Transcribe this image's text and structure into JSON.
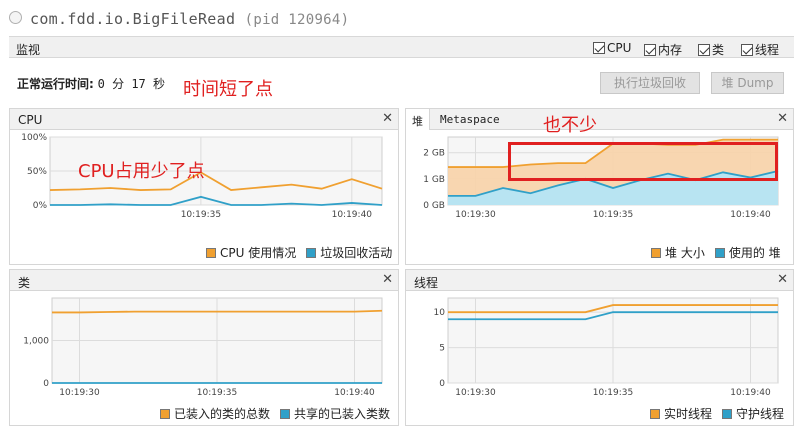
{
  "window": {
    "title": "com.fdd.io.BigFileRead",
    "pid": "(pid 120964)"
  },
  "monitor": {
    "label": "监视",
    "checkboxes": [
      {
        "label": "CPU",
        "checked": true
      },
      {
        "label": "内存",
        "checked": true
      },
      {
        "label": "类",
        "checked": true
      },
      {
        "label": "线程",
        "checked": true
      }
    ]
  },
  "uptime": {
    "label": "正常运行时间:",
    "value": "0 分 17 秒"
  },
  "buttons": {
    "gc": "执行垃圾回收",
    "dump": "堆 Dump"
  },
  "annotations": {
    "time": "时间短了点",
    "cpu": "CPU占用少了点",
    "heap": "也不少"
  },
  "colors": {
    "orange": "#f0a030",
    "orange_fill": "#f8d3a8",
    "blue": "#30a0c8",
    "blue_fill": "#b8e4f2",
    "annotation": "#e02020"
  },
  "panels": {
    "cpu": {
      "title": "CPU",
      "legend": [
        "CPU 使用情况",
        "垃圾回收活动"
      ]
    },
    "heap": {
      "tabs": [
        "堆",
        "Metaspace"
      ],
      "legend": [
        "堆 大小",
        "使用的 堆"
      ]
    },
    "classes": {
      "title": "类",
      "legend": [
        "已装入的类的总数",
        "共享的已装入类数"
      ]
    },
    "threads": {
      "title": "线程",
      "legend": [
        "实时线程",
        "守护线程"
      ]
    }
  },
  "chart_data": [
    {
      "type": "line",
      "panel": "cpu",
      "x": [
        "10:19:30",
        "10:19:31",
        "10:19:32",
        "10:19:33",
        "10:19:34",
        "10:19:35",
        "10:19:36",
        "10:19:37",
        "10:19:38",
        "10:19:39",
        "10:19:40",
        "10:19:41"
      ],
      "xticks": [
        "10:19:35",
        "10:19:40"
      ],
      "yticks": [
        "0%",
        "50%",
        "100%"
      ],
      "ylim": [
        0,
        100
      ],
      "series": [
        {
          "name": "CPU 使用情况",
          "values": [
            22,
            23,
            25,
            22,
            23,
            48,
            22,
            26,
            30,
            24,
            38,
            24
          ]
        },
        {
          "name": "垃圾回收活动",
          "values": [
            0,
            0,
            1,
            0,
            0,
            12,
            0,
            0,
            2,
            0,
            3,
            0
          ]
        }
      ]
    },
    {
      "type": "area",
      "panel": "heap",
      "x": [
        "10:19:29",
        "10:19:30",
        "10:19:31",
        "10:19:32",
        "10:19:33",
        "10:19:34",
        "10:19:35",
        "10:19:36",
        "10:19:37",
        "10:19:38",
        "10:19:39",
        "10:19:40",
        "10:19:41"
      ],
      "xticks": [
        "10:19:30",
        "10:19:35",
        "10:19:40"
      ],
      "yticks": [
        "0 GB",
        "1 GB",
        "2 GB"
      ],
      "ylim": [
        0,
        2.6
      ],
      "series": [
        {
          "name": "堆 大小",
          "values": [
            1.45,
            1.45,
            1.45,
            1.55,
            1.6,
            1.6,
            2.35,
            2.35,
            2.3,
            2.3,
            2.5,
            2.5,
            2.5
          ]
        },
        {
          "name": "使用的 堆",
          "values": [
            0.35,
            0.35,
            0.65,
            0.45,
            0.75,
            1.0,
            0.65,
            0.95,
            1.2,
            0.95,
            1.25,
            1.05,
            1.3
          ]
        }
      ]
    },
    {
      "type": "line",
      "panel": "classes",
      "x": [
        "10:19:29",
        "10:19:30",
        "10:19:31",
        "10:19:32",
        "10:19:33",
        "10:19:34",
        "10:19:35",
        "10:19:36",
        "10:19:37",
        "10:19:38",
        "10:19:39",
        "10:19:40",
        "10:19:41"
      ],
      "xticks": [
        "10:19:30",
        "10:19:35",
        "10:19:40"
      ],
      "yticks": [
        "0",
        "1,000"
      ],
      "ylim": [
        0,
        2000
      ],
      "series": [
        {
          "name": "已装入的类的总数",
          "values": [
            1660,
            1660,
            1670,
            1680,
            1680,
            1680,
            1680,
            1680,
            1680,
            1680,
            1680,
            1680,
            1700
          ]
        },
        {
          "name": "共享的已装入类数",
          "values": [
            0,
            0,
            0,
            0,
            0,
            0,
            0,
            0,
            0,
            0,
            0,
            0,
            0
          ]
        }
      ]
    },
    {
      "type": "line",
      "panel": "threads",
      "x": [
        "10:19:29",
        "10:19:30",
        "10:19:31",
        "10:19:32",
        "10:19:33",
        "10:19:34",
        "10:19:35",
        "10:19:36",
        "10:19:37",
        "10:19:38",
        "10:19:39",
        "10:19:40",
        "10:19:41"
      ],
      "xticks": [
        "10:19:30",
        "10:19:35",
        "10:19:40"
      ],
      "yticks": [
        "0",
        "5",
        "10"
      ],
      "ylim": [
        0,
        12
      ],
      "series": [
        {
          "name": "实时线程",
          "values": [
            10,
            10,
            10,
            10,
            10,
            10,
            11,
            11,
            11,
            11,
            11,
            11,
            11
          ]
        },
        {
          "name": "守护线程",
          "values": [
            9,
            9,
            9,
            9,
            9,
            9,
            10,
            10,
            10,
            10,
            10,
            10,
            10
          ]
        }
      ]
    }
  ]
}
